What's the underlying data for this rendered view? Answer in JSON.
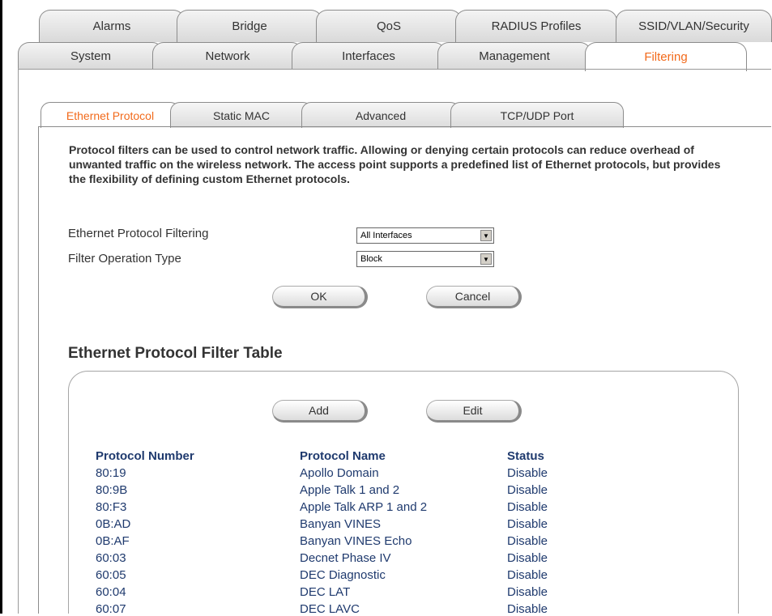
{
  "top_tabs_row1": [
    "Alarms",
    "Bridge",
    "QoS",
    "RADIUS Profiles",
    "SSID/VLAN/Security"
  ],
  "top_tabs_row2": [
    "System",
    "Network",
    "Interfaces",
    "Management",
    "Filtering"
  ],
  "sub_tabs": [
    "Ethernet Protocol",
    "Static MAC",
    "Advanced",
    "TCP/UDP Port"
  ],
  "description": "Protocol filters can be used to control network traffic. Allowing or denying certain protocols can reduce overhead of unwanted traffic on the wireless network. The access point supports a predefined list of Ethernet protocols, but provides the flexibility of defining custom Ethernet protocols.",
  "form": {
    "filtering_label": "Ethernet Protocol Filtering",
    "filtering_value": "All Interfaces",
    "operation_label": "Filter Operation Type",
    "operation_value": "Block",
    "ok_label": "OK",
    "cancel_label": "Cancel"
  },
  "table": {
    "title": "Ethernet Protocol Filter Table",
    "add_label": "Add",
    "edit_label": "Edit",
    "headers": [
      "Protocol Number",
      "Protocol Name",
      "Status"
    ],
    "rows": [
      [
        "80:19",
        "Apollo Domain",
        "Disable"
      ],
      [
        "80:9B",
        "Apple Talk 1 and 2",
        "Disable"
      ],
      [
        "80:F3",
        "Apple Talk ARP 1 and 2",
        "Disable"
      ],
      [
        "0B:AD",
        "Banyan VINES",
        "Disable"
      ],
      [
        "0B:AF",
        "Banyan VINES Echo",
        "Disable"
      ],
      [
        "60:03",
        "Decnet Phase IV",
        "Disable"
      ],
      [
        "60:05",
        "DEC Diagnostic",
        "Disable"
      ],
      [
        "60:04",
        "DEC LAT",
        "Disable"
      ],
      [
        "60:07",
        "DEC LAVC",
        "Disable"
      ]
    ]
  },
  "colors": {
    "active_tab_text": "#f26a1b",
    "table_text": "#1f3a6e"
  }
}
